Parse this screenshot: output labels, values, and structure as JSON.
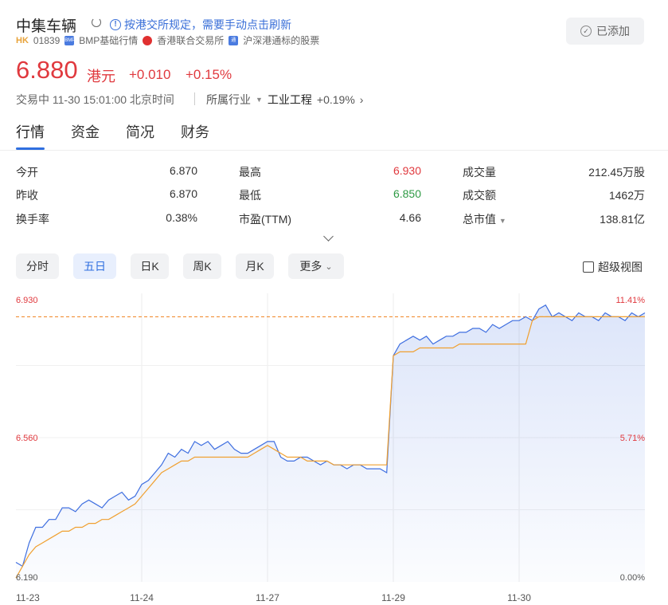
{
  "header": {
    "title": "中集车辆",
    "notice": "按港交所规定，需要手动点击刷新",
    "market": "HK",
    "code": "01839",
    "tags": [
      "BMP基础行情",
      "香港联合交易所",
      "沪深港通标的股票"
    ],
    "add_button": "已添加"
  },
  "quote": {
    "price": "6.880",
    "unit": "港元",
    "change": "+0.010",
    "change_pct": "+0.15%",
    "status": "交易中 11-30 15:01:00 北京时间",
    "industry_label": "所属行业",
    "industry_name": "工业工程",
    "industry_change": "+0.19%"
  },
  "tabs": [
    "行情",
    "资金",
    "简况",
    "财务"
  ],
  "stats": [
    {
      "label": "今开",
      "value": "6.870"
    },
    {
      "label": "最高",
      "value": "6.930"
    },
    {
      "label": "成交量",
      "value": "212.45万股"
    },
    {
      "label": "昨收",
      "value": "6.870"
    },
    {
      "label": "最低",
      "value": "6.850"
    },
    {
      "label": "成交额",
      "value": "1462万"
    },
    {
      "label": "换手率",
      "value": "0.38%"
    },
    {
      "label": "市盈(TTM)",
      "value": "4.66"
    },
    {
      "label": "总市值",
      "value": "138.81亿"
    }
  ],
  "periods": [
    "分时",
    "五日",
    "日K",
    "周K",
    "月K",
    "更多"
  ],
  "active_period": "五日",
  "super_view": "超级视图",
  "colors": {
    "up": "#e0393e",
    "down": "#2e9a44",
    "price_line": "#3f6fe0",
    "avg_line": "#f0a030",
    "accent": "#2f6fe0"
  },
  "chart_data": {
    "type": "line",
    "x_labels": [
      "11-23",
      "11-24",
      "11-27",
      "11-29",
      "11-30"
    ],
    "ylim": [
      6.19,
      6.93
    ],
    "y_ticks_left": [
      "6.930",
      "6.560",
      "6.190"
    ],
    "y_ticks_right": [
      "11.41%",
      "5.71%",
      "0.00%"
    ],
    "reference_line": 6.87,
    "series": [
      {
        "values": [
          6.24,
          6.23,
          6.29,
          6.33,
          6.33,
          6.35,
          6.35,
          6.38,
          6.38,
          6.37,
          6.39,
          6.4,
          6.39,
          6.38,
          6.4,
          6.41,
          6.42,
          6.4,
          6.41,
          6.44,
          6.45,
          6.47,
          6.49,
          6.52,
          6.51,
          6.53,
          6.52,
          6.55,
          6.54,
          6.55,
          6.53,
          6.54,
          6.55,
          6.53,
          6.52,
          6.52,
          6.53,
          6.54,
          6.55,
          6.55,
          6.51,
          6.5,
          6.5,
          6.51,
          6.51,
          6.5,
          6.49,
          6.5,
          6.49,
          6.49,
          6.48,
          6.49,
          6.49,
          6.48,
          6.48,
          6.48,
          6.47,
          6.77,
          6.8,
          6.81,
          6.82,
          6.81,
          6.82,
          6.8,
          6.81,
          6.82,
          6.82,
          6.83,
          6.83,
          6.84,
          6.84,
          6.83,
          6.85,
          6.84,
          6.85,
          6.86,
          6.86,
          6.87,
          6.86,
          6.89,
          6.9,
          6.87,
          6.88,
          6.87,
          6.86,
          6.88,
          6.87,
          6.87,
          6.86,
          6.88,
          6.87,
          6.87,
          6.86,
          6.88,
          6.87,
          6.88
        ]
      },
      {
        "values": [
          6.2,
          6.23,
          6.26,
          6.28,
          6.29,
          6.3,
          6.31,
          6.32,
          6.32,
          6.33,
          6.33,
          6.34,
          6.34,
          6.35,
          6.35,
          6.36,
          6.37,
          6.38,
          6.39,
          6.41,
          6.43,
          6.45,
          6.47,
          6.48,
          6.49,
          6.5,
          6.5,
          6.51,
          6.51,
          6.51,
          6.51,
          6.51,
          6.51,
          6.51,
          6.51,
          6.51,
          6.52,
          6.53,
          6.54,
          6.53,
          6.52,
          6.51,
          6.51,
          6.51,
          6.5,
          6.5,
          6.5,
          6.5,
          6.49,
          6.49,
          6.49,
          6.49,
          6.49,
          6.49,
          6.49,
          6.49,
          6.49,
          6.77,
          6.78,
          6.78,
          6.78,
          6.79,
          6.79,
          6.79,
          6.79,
          6.79,
          6.79,
          6.8,
          6.8,
          6.8,
          6.8,
          6.8,
          6.8,
          6.8,
          6.8,
          6.8,
          6.8,
          6.8,
          6.86,
          6.87,
          6.87,
          6.87,
          6.87,
          6.87,
          6.87,
          6.87,
          6.87,
          6.87,
          6.87,
          6.87,
          6.87,
          6.87,
          6.87,
          6.87,
          6.87,
          6.87
        ]
      }
    ]
  }
}
